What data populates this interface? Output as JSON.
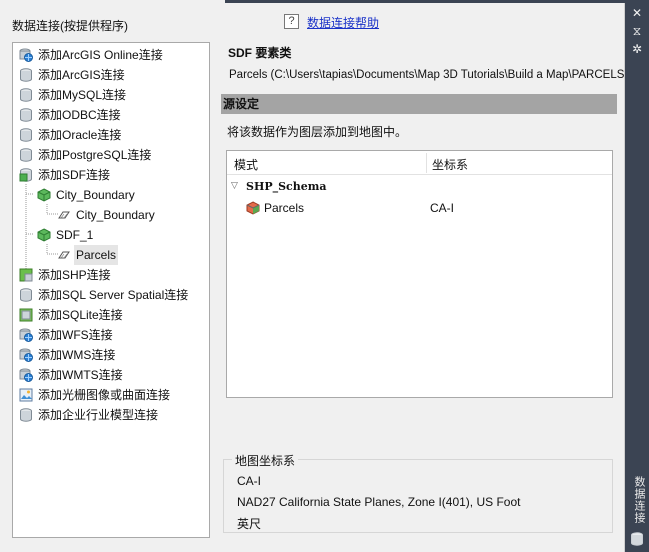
{
  "panel_title": "数据连接(按提供程序)",
  "help_icon": "?",
  "help_link": "数据连接帮助",
  "side": {
    "title": "数据连接",
    "close_glyph": "✕",
    "pin_glyph": "⧖",
    "settings_glyph": "✲"
  },
  "tree_items": [
    {
      "label": "添加ArcGIS Online连接",
      "icon": "globe-db-icon"
    },
    {
      "label": "添加ArcGIS连接",
      "icon": "database-icon"
    },
    {
      "label": "添加MySQL连接",
      "icon": "database-icon"
    },
    {
      "label": "添加ODBC连接",
      "icon": "database-icon"
    },
    {
      "label": "添加Oracle连接",
      "icon": "database-icon"
    },
    {
      "label": "添加PostgreSQL连接",
      "icon": "database-icon"
    },
    {
      "label": "添加SDF连接",
      "icon": "sdf-icon"
    },
    {
      "label": "City_Boundary",
      "icon": "cube-icon"
    },
    {
      "label": "City_Boundary",
      "icon": "polygon-icon"
    },
    {
      "label": "SDF_1",
      "icon": "cube-icon"
    },
    {
      "label": "Parcels",
      "icon": "polygon-icon"
    },
    {
      "label": "添加SHP连接",
      "icon": "shp-icon"
    },
    {
      "label": "添加SQL Server Spatial连接",
      "icon": "database-icon"
    },
    {
      "label": "添加SQLite连接",
      "icon": "sqlite-icon"
    },
    {
      "label": "添加WFS连接",
      "icon": "globe-db-icon"
    },
    {
      "label": "添加WMS连接",
      "icon": "globe-db-icon"
    },
    {
      "label": "添加WMTS连接",
      "icon": "globe-db-icon"
    },
    {
      "label": "添加光栅图像或曲面连接",
      "icon": "raster-icon"
    },
    {
      "label": "添加企业行业模型连接",
      "icon": "database-icon"
    }
  ],
  "detail": {
    "heading": "SDF 要素类",
    "path": "Parcels (C:\\Users\\tapias\\Documents\\Map 3D Tutorials\\Build a Map\\PARCELS.",
    "source_bar": "源设定",
    "source_desc": "将该数据作为图层添加到地图中。",
    "grid": {
      "col_schema": "模式",
      "col_cs": "坐标系",
      "schema_name": "SHP_Schema",
      "rows": [
        {
          "name": "Parcels",
          "cs": "CA-I"
        }
      ]
    },
    "map_cs": {
      "legend": "地图坐标系",
      "code": "CA-I",
      "description": "NAD27 California State Planes, Zone I(401), US Foot",
      "unit": "英尺"
    }
  },
  "colors": {
    "side_strip": "#3b4453",
    "link": "#1a32c8",
    "source_bar": "#a4a4a4",
    "db_gray": "#bfc6cc",
    "sdf_green": "#4caf50"
  }
}
